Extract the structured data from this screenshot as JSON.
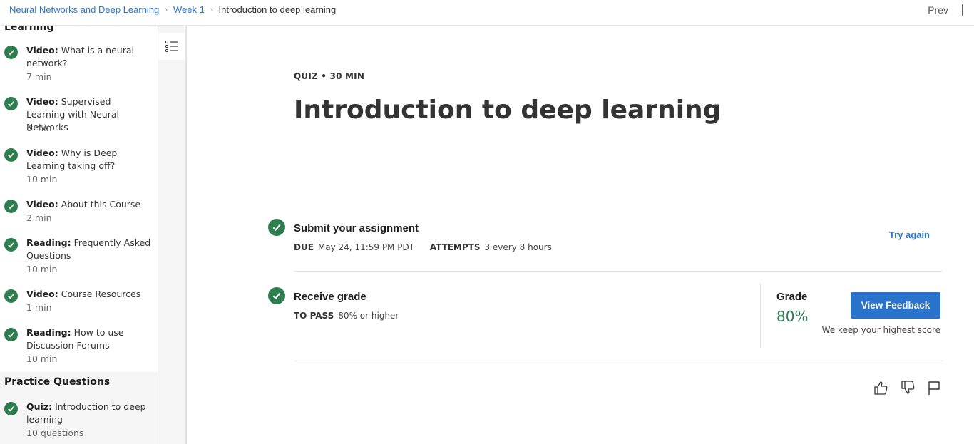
{
  "breadcrumb": {
    "course": "Neural Networks and Deep Learning",
    "week": "Week 1",
    "current": "Introduction to deep learning"
  },
  "nav": {
    "prev_label": "Prev"
  },
  "sidebar": {
    "section_cut": "Learning",
    "items": [
      {
        "type": "Video:",
        "title": "What is a neural network?",
        "duration": "7 min"
      },
      {
        "type": "Video:",
        "title": "Supervised Learning with Neural Networks",
        "duration": "8 min"
      },
      {
        "type": "Video:",
        "title": "Why is Deep Learning taking off?",
        "duration": "10 min"
      },
      {
        "type": "Video:",
        "title": "About this Course",
        "duration": "2 min"
      },
      {
        "type": "Reading:",
        "title": "Frequently Asked Questions",
        "duration": "10 min"
      },
      {
        "type": "Video:",
        "title": "Course Resources",
        "duration": "1 min"
      },
      {
        "type": "Reading:",
        "title": "How to use Discussion Forums",
        "duration": "10 min"
      }
    ],
    "practice": {
      "title": "Practice Questions",
      "item": {
        "type": "Quiz:",
        "title": "Introduction to deep learning",
        "duration": "10 questions"
      }
    }
  },
  "main": {
    "kicker": "QUIZ • 30 MIN",
    "title": "Introduction to deep learning",
    "submit": {
      "title": "Submit your assignment",
      "due_label": "DUE",
      "due_value": "May 24, 11:59 PM PDT",
      "attempts_label": "ATTEMPTS",
      "attempts_value": "3 every 8 hours",
      "try_again": "Try again"
    },
    "receive": {
      "title": "Receive grade",
      "pass_label": "TO PASS",
      "pass_value": "80% or higher"
    },
    "grade": {
      "label": "Grade",
      "value": "80%",
      "button": "View Feedback",
      "note": "We keep your highest score"
    }
  },
  "colors": {
    "accent": "#2a73cc",
    "success": "#2e7d4f"
  }
}
